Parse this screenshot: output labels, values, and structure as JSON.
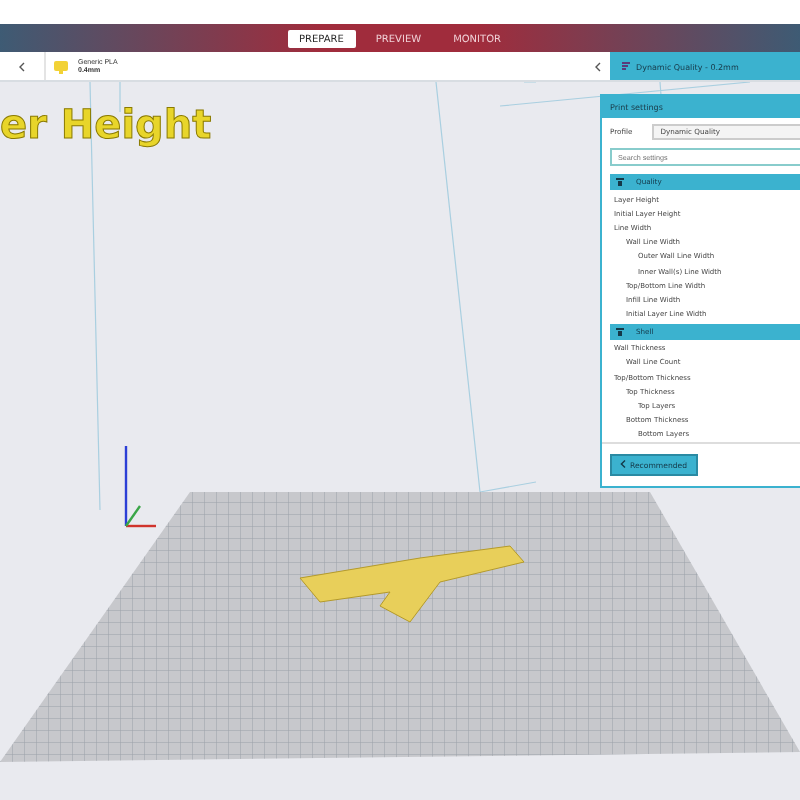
{
  "header": {
    "tabs": [
      {
        "label": "PREPARE",
        "selected": true
      },
      {
        "label": "PREVIEW",
        "selected": false
      },
      {
        "label": "MONITOR",
        "selected": false
      }
    ]
  },
  "toolbar": {
    "material": {
      "name": "Generic PLA",
      "size": "0.4mm"
    },
    "profile_button": "Dynamic Quality - 0.2mm"
  },
  "viewport_title": "er Height",
  "settings_panel": {
    "title": "Print settings",
    "profile_label": "Profile",
    "profile_value": "Dynamic Quality",
    "search": {
      "placeholder": "Search settings"
    },
    "categories": [
      {
        "label": "Quality",
        "children": [
          {
            "label": "Layer Height"
          },
          {
            "label": "Initial Layer Height"
          },
          {
            "label": "Line Width",
            "children": [
              {
                "label": "Wall Line Width",
                "children": [
                  {
                    "label": "Outer Wall Line Width"
                  },
                  {
                    "label": "Inner Wall(s) Line Width"
                  }
                ]
              },
              {
                "label": "Top/Bottom Line Width"
              },
              {
                "label": "Infill Line Width"
              },
              {
                "label": "Initial Layer Line Width"
              }
            ]
          }
        ]
      },
      {
        "label": "Shell",
        "children": [
          {
            "label": "Wall Thickness",
            "children": [
              {
                "label": "Wall Line Count"
              }
            ]
          },
          {
            "label": "Top/Bottom Thickness",
            "children": [
              {
                "label": "Top Thickness",
                "children": [
                  {
                    "label": "Top Layers"
                  }
                ]
              },
              {
                "label": "Bottom Thickness",
                "children": [
                  {
                    "label": "Bottom Layers"
                  }
                ]
              }
            ]
          }
        ]
      }
    ],
    "recommended_button": "Recommended"
  }
}
